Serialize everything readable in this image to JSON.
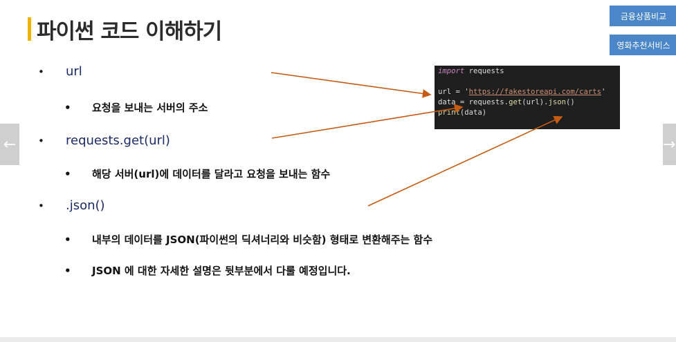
{
  "slide": {
    "title": "파이썬 코드 이해하기"
  },
  "side_buttons": [
    "금융상품비교",
    "영화추천서비스"
  ],
  "nav": {
    "prev": "←",
    "next": "→"
  },
  "bullets": [
    {
      "level": 1,
      "text": "url"
    },
    {
      "level": 2,
      "text": "요청을 보내는 서버의 주소"
    },
    {
      "level": 1,
      "text": "requests.get(url)"
    },
    {
      "level": 2,
      "text": "해당 서버(url)에 데이터를 달라고 요청을 보내는 함수"
    },
    {
      "level": 1,
      "text": ".json()"
    },
    {
      "level": 2,
      "text": "내부의 데이터를 JSON(파이썬의 딕셔너리와 비슷함) 형태로 변환해주는 함수"
    },
    {
      "level": 2,
      "text": "JSON 에 대한 자세한 설명은 뒷부분에서 다룰 예정입니다."
    }
  ],
  "code": {
    "l1_kw": "import",
    "l1_rest": " requests",
    "l2_a": "url = '",
    "l2_str": "https://fakestoreapi.com/carts",
    "l2_b": "'",
    "l3_a": "data = requests.",
    "l3_fn1": "get",
    "l3_b": "(url).",
    "l3_fn2": "json",
    "l3_c": "()",
    "l4_fn": "print",
    "l4_rest": "(data)"
  },
  "colors": {
    "accent_bar": "#f0b400",
    "side_button": "#4a86c8",
    "arrow": "#c55a11",
    "code_bg": "#1e1e1e"
  }
}
